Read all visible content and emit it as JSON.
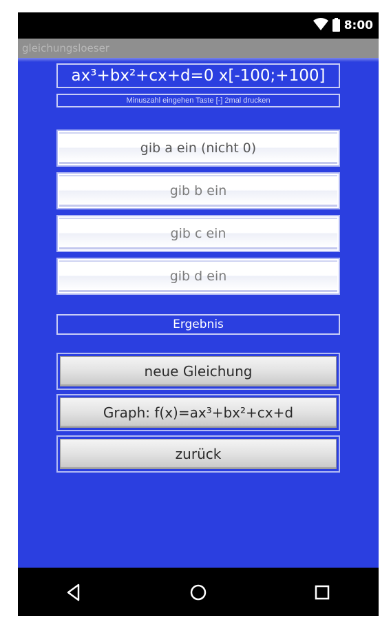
{
  "status_bar": {
    "time": "8:00",
    "icons": [
      "wifi-icon",
      "battery-icon"
    ]
  },
  "app": {
    "title": "gleichungsloeser"
  },
  "main": {
    "equation": "ax³+bx²+cx+d=0   x[-100;+100]",
    "hint": "Minuszahl eingehen    Taste [-] 2mal drucken",
    "inputs": [
      {
        "placeholder": "gib a ein (nicht 0)",
        "value": ""
      },
      {
        "placeholder": "gib b ein",
        "value": ""
      },
      {
        "placeholder": "gib c ein",
        "value": ""
      },
      {
        "placeholder": "gib d ein",
        "value": ""
      }
    ],
    "result_label": "Ergebnis",
    "buttons": {
      "new_equation": "neue Gleichung",
      "graph": "Graph: f(x)=ax³+bx²+cx+d",
      "back": "zurück"
    }
  },
  "nav_bar": {
    "icons": [
      "back-triangle-icon",
      "home-circle-icon",
      "recents-square-icon"
    ]
  },
  "colors": {
    "background_blue": "#2b3fe0",
    "title_bar": "#8f8f8f",
    "system_bars": "#000000"
  }
}
